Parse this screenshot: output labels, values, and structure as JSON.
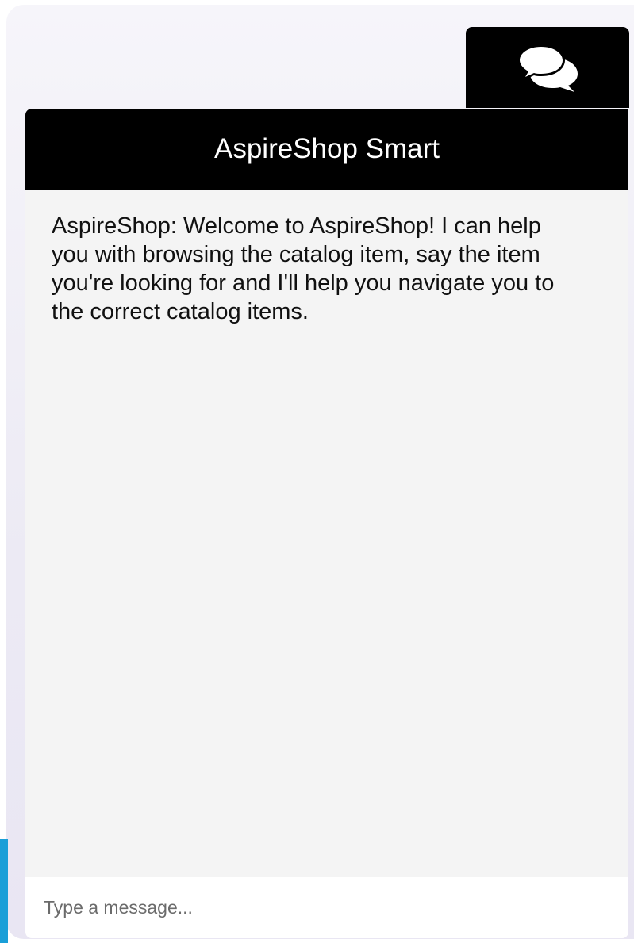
{
  "chat_widget": {
    "toggle_icon": "chat-bubbles-icon",
    "header_title": "AspireShop Smart",
    "messages": [
      {
        "text": "AspireShop: Welcome to AspireShop! I can help you with browsing the catalog item, say the item you're looking for and I'll help you navigate you to the correct catalog items."
      }
    ],
    "input": {
      "value": "",
      "placeholder": "Type a message..."
    }
  },
  "colors": {
    "header_background": "#000000",
    "header_text": "#ffffff",
    "body_background": "#f4f4f4",
    "accent": "#1a9fd8"
  }
}
